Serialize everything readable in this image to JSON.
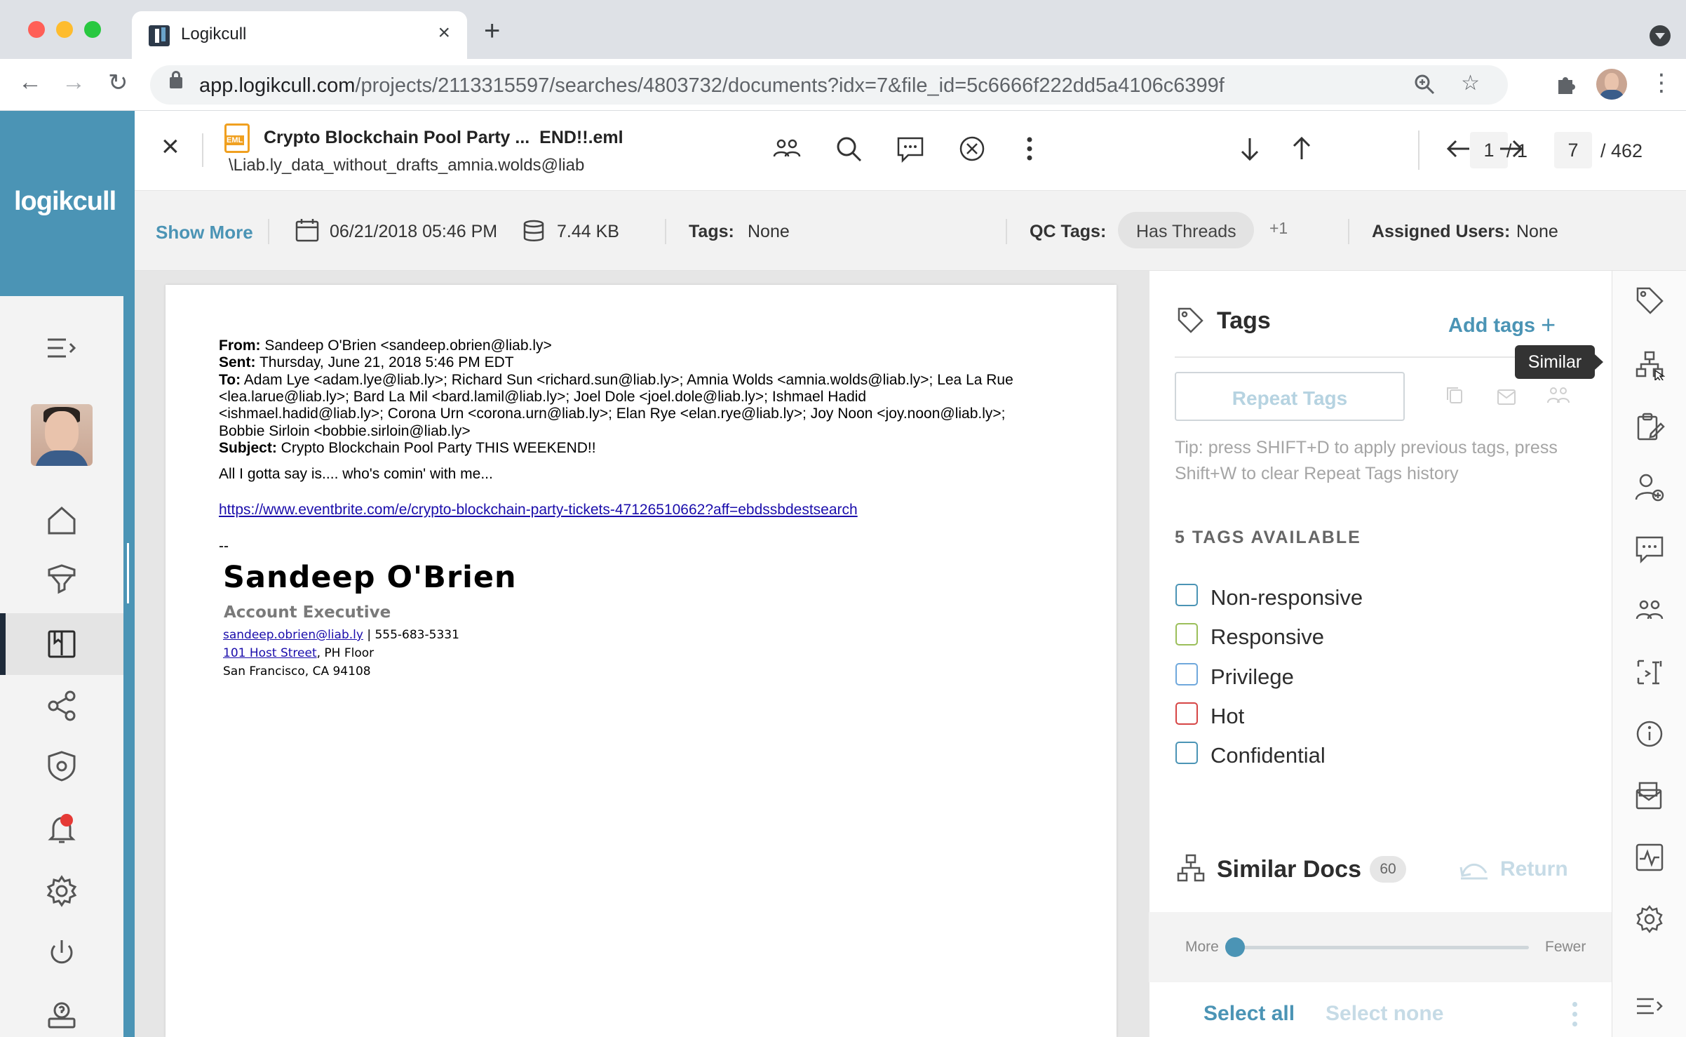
{
  "browser": {
    "tab_title": "Logikcull",
    "url_host": "app.logikcull.com",
    "url_path": "/projects/2113315597/searches/4803732/documents?idx=7&file_id=5c6666f222dd5a4106c6399f"
  },
  "brand": {
    "logo_text": "logikcull"
  },
  "doc_header": {
    "file_name": "Crypto Blockchain Pool Party ...  END!!.eml",
    "file_path": "\\Liab.ly_data_without_drafts_amnia.wolds@liab",
    "file_badge": "EML",
    "hit_current": "1",
    "hit_total": "/ 1",
    "doc_current": "7",
    "doc_total": "/ 462"
  },
  "doc_meta": {
    "show_more": "Show More",
    "date": "06/21/2018 05:46 PM",
    "size": "7.44 KB",
    "tags_label": "Tags:",
    "tags_value": "None",
    "qc_tags_label": "QC Tags:",
    "qc_tag": "Has Threads",
    "qc_more": "+1",
    "assigned_label": "Assigned Users:",
    "assigned_value": "None"
  },
  "email": {
    "from_label": "From:",
    "from": " Sandeep O'Brien <sandeep.obrien@liab.ly>",
    "sent_label": "Sent:",
    "sent": " Thursday, June 21, 2018 5:46 PM EDT",
    "to_label": "To:",
    "to_line1": " Adam Lye <adam.lye@liab.ly>; Richard Sun <richard.sun@liab.ly>; Amnia Wolds <amnia.wolds@liab.ly>; Lea La Rue",
    "to_line2": "<lea.larue@liab.ly>; Bard La Mil <bard.lamil@liab.ly>; Joel Dole <joel.dole@liab.ly>; Ishmael Hadid",
    "to_line3": "<ishmael.hadid@liab.ly>; Corona Urn <corona.urn@liab.ly>; Elan Rye <elan.rye@liab.ly>; Joy Noon <joy.noon@liab.ly>;",
    "to_line4": "Bobbie Sirloin <bobbie.sirloin@liab.ly>",
    "subject_label": "Subject:",
    "subject": " Crypto Blockchain Pool Party THIS WEEKEND!!",
    "body": "All I gotta say is.... who's comin' with me...",
    "link": "https://www.eventbrite.com/e/crypto-blockchain-party-tickets-47126510662?aff=ebdssbdestsearch",
    "sig_dash": "--",
    "sig_name": "Sandeep O'Brien",
    "sig_title": "Account Executive",
    "sig_email": "sandeep.obrien@liab.ly",
    "sig_phone": " | 555-683-5331",
    "sig_street": "101 Host Street",
    "sig_floor": ", PH Floor",
    "sig_city": "San Francisco, CA 94108"
  },
  "tags_panel": {
    "title": "Tags",
    "add_tags": "Add tags",
    "repeat_tags": "Repeat Tags",
    "tip": "Tip: press SHIFT+D to apply previous tags, press Shift+W to clear Repeat Tags history",
    "available_heading": "5 TAGS AVAILABLE",
    "tags": [
      {
        "label": "Non-responsive",
        "color": "#4b94b5"
      },
      {
        "label": "Responsive",
        "color": "#9bbf5a"
      },
      {
        "label": "Privilege",
        "color": "#6fa8dc"
      },
      {
        "label": "Hot",
        "color": "#d64545"
      },
      {
        "label": "Confidential",
        "color": "#4b94b5"
      }
    ],
    "similar_title": "Similar Docs",
    "similar_count": "60",
    "return_label": "Return",
    "slider_left": "More",
    "slider_right": "Fewer",
    "slider_position": 0,
    "select_all": "Select all",
    "select_none": "Select none"
  },
  "tooltip": "Similar",
  "colors": {
    "accent": "#4b94b5",
    "nav_dark": "#1e2b3a",
    "notification": "#e53935"
  }
}
